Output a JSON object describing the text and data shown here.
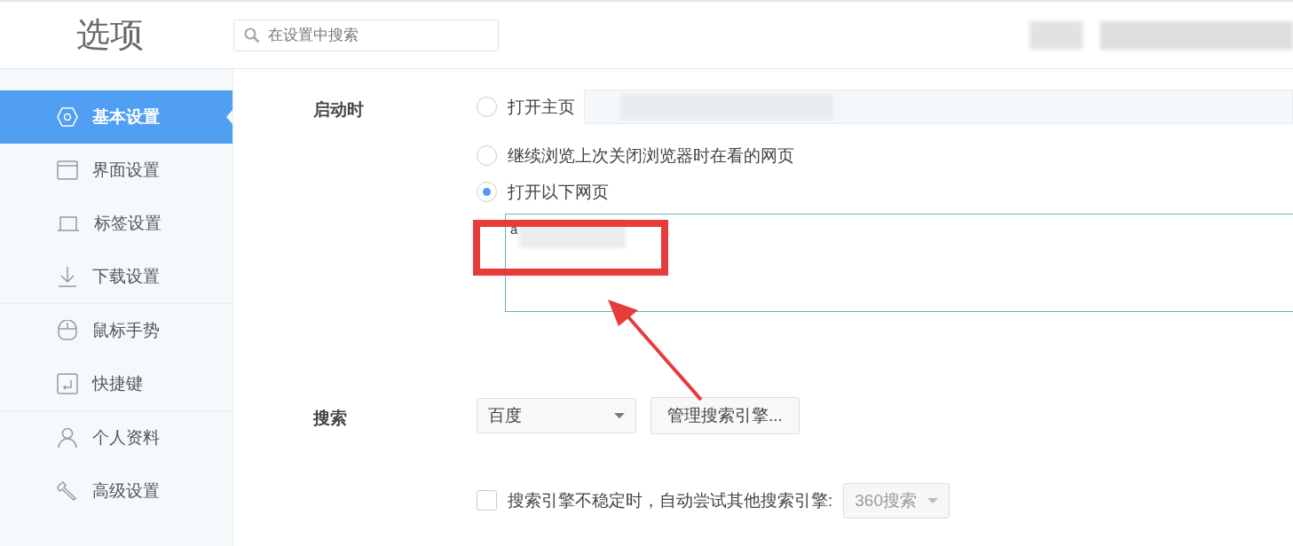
{
  "header": {
    "title": "选项",
    "search": {
      "placeholder": "在设置中搜索"
    }
  },
  "sidebar": {
    "groups": [
      [
        {
          "label": "基本设置",
          "selected": true
        },
        {
          "label": "界面设置",
          "selected": false
        },
        {
          "label": "标签设置",
          "selected": false
        },
        {
          "label": "下载设置",
          "selected": false
        }
      ],
      [
        {
          "label": "鼠标手势",
          "selected": false
        },
        {
          "label": "快捷键",
          "selected": false
        }
      ],
      [
        {
          "label": "个人资料",
          "selected": false
        },
        {
          "label": "高级设置",
          "selected": false
        }
      ]
    ]
  },
  "startup": {
    "label": "启动时",
    "options": [
      {
        "kind": "homepage",
        "label": "打开主页",
        "selected": false
      },
      {
        "kind": "plain",
        "label": "继续浏览上次关闭浏览器时在看的网页",
        "selected": false
      },
      {
        "kind": "pages",
        "label": "打开以下网页",
        "selected": true,
        "value": "a"
      }
    ]
  },
  "search": {
    "label": "搜索",
    "engine": "百度",
    "manage_button": "管理搜索引擎...",
    "fallback": {
      "label": "搜索引擎不稳定时，自动尝试其他搜索引擎:",
      "checked": false,
      "engine": "360搜索",
      "disabled": true
    }
  }
}
